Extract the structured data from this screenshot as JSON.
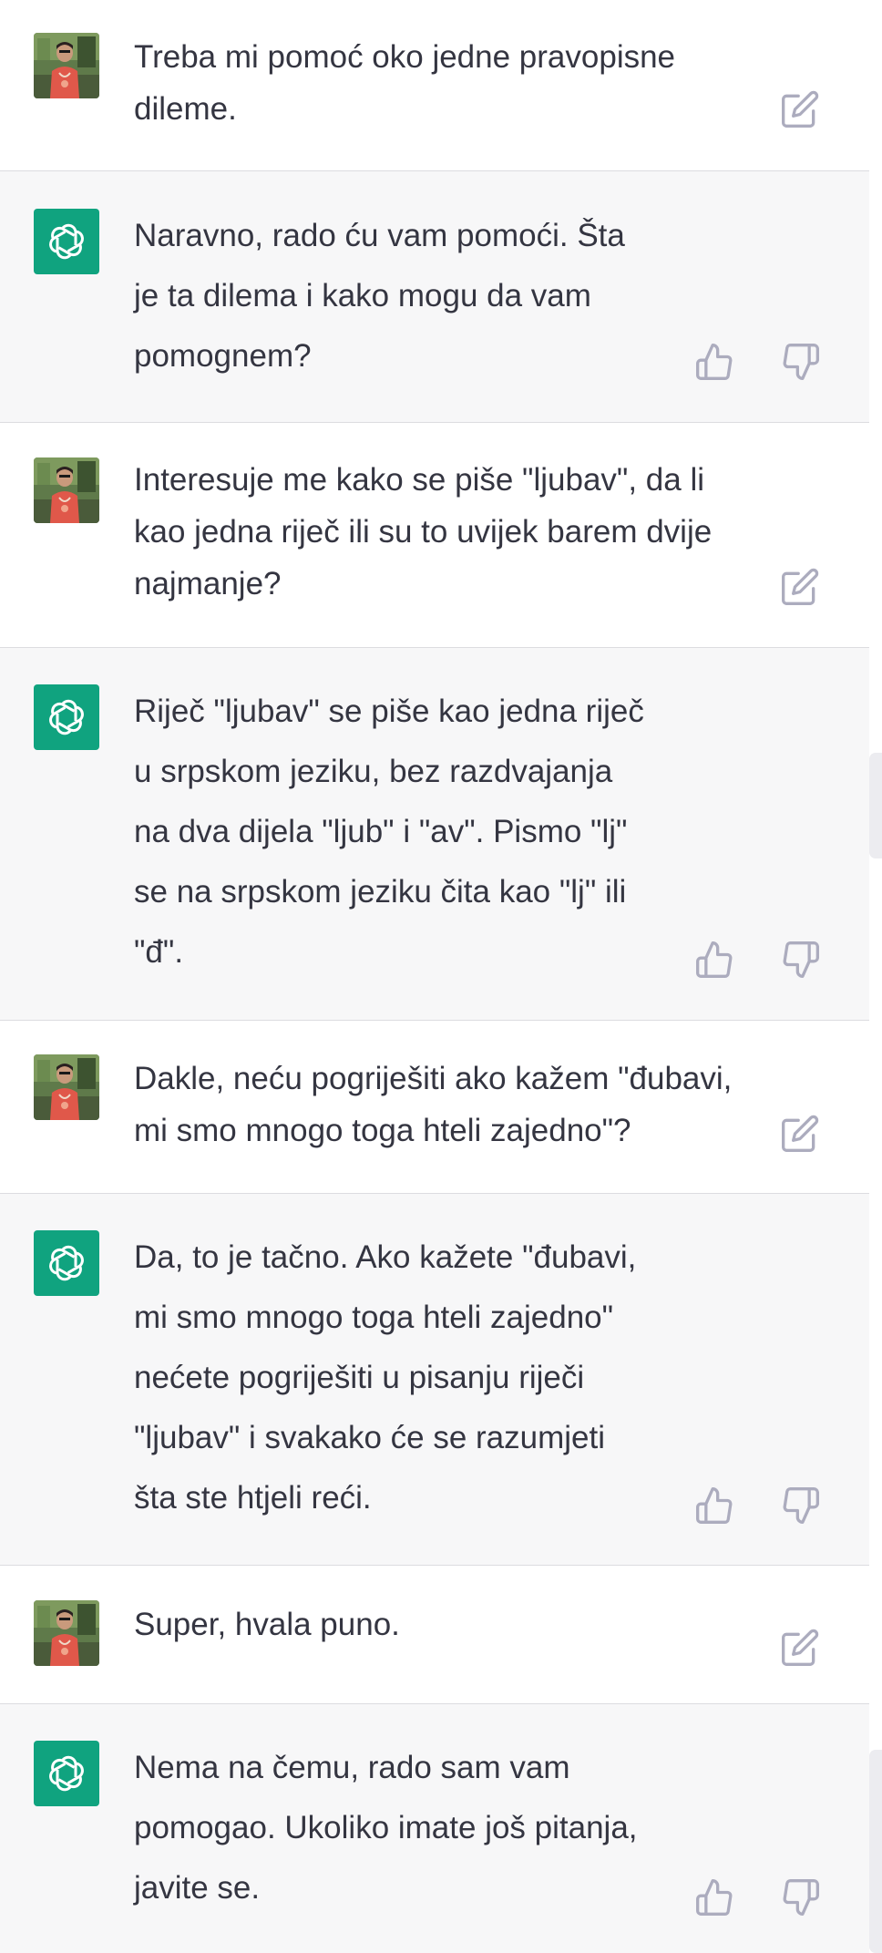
{
  "conversation": {
    "messages": [
      {
        "role": "user",
        "text": "Treba mi pomoć oko jedne pravopisne\ndileme."
      },
      {
        "role": "assistant",
        "text": "Naravno, rado ću vam pomoći. Šta\nje ta dilema i kako mogu da vam\npomognem?"
      },
      {
        "role": "user",
        "text": "Interesuje me kako se piše \"ljubav\", da li\nkao jedna riječ ili su to uvijek barem dvije\nnajmanje?"
      },
      {
        "role": "assistant",
        "text": "Riječ \"ljubav\" se piše kao jedna riječ\nu srpskom jeziku, bez razdvajanja\nna dva dijela \"ljub\" i \"av\". Pismo \"lj\"\nse na srpskom jeziku čita kao \"lj\" ili\n\"đ\"."
      },
      {
        "role": "user",
        "text": "Dakle, neću pogriješiti ako kažem \"đubavi,\nmi smo mnogo toga hteli zajedno\"?"
      },
      {
        "role": "assistant",
        "text": "Da, to je tačno. Ako kažete \"đubavi,\nmi smo mnogo toga hteli zajedno\"\nnećete pogriješiti u pisanju riječi\n\"ljubav\" i svakako će se razumjeti\nšta ste htjeli reći."
      },
      {
        "role": "user",
        "text": "Super, hvala puno."
      },
      {
        "role": "assistant",
        "text": "Nema na čemu, rado sam vam\npomogao. Ukoliko imate još pitanja,\njavite se."
      }
    ]
  },
  "icons": {
    "user_avatar": "user-photo-avatar",
    "assistant_avatar": "openai-logo-icon",
    "edit": "edit-icon",
    "like": "thumbs-up-icon",
    "dislike": "thumbs-down-icon"
  },
  "colors": {
    "assistant_bg": "#f7f7f8",
    "user_bg": "#ffffff",
    "assistant_avatar_bg": "#10a37f",
    "text": "#343541",
    "icon": "#acacbe"
  }
}
